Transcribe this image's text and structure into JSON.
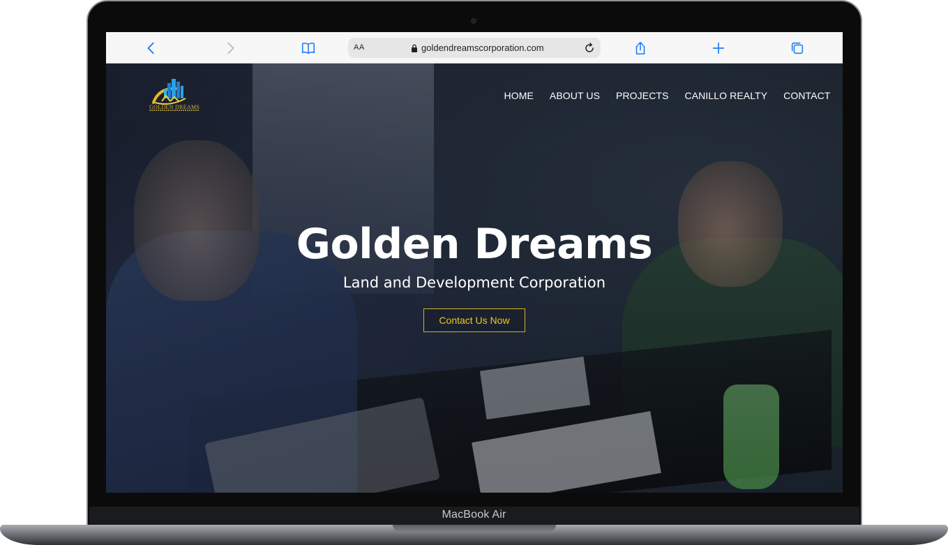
{
  "device": {
    "label": "MacBook Air"
  },
  "browser": {
    "reader_size_label": "AA",
    "url": "goldendreamscorporation.com",
    "icons": {
      "back": "chevron-left-icon",
      "forward": "chevron-right-icon",
      "bookmarks": "book-icon",
      "lock": "lock-icon",
      "reload": "reload-icon",
      "share": "share-icon",
      "new_tab": "plus-icon",
      "tabs": "tabs-icon"
    },
    "accent_color": "#1b7cf5"
  },
  "site": {
    "logo_text": "GOLDEN DREAMS",
    "nav": [
      "HOME",
      "ABOUT US",
      "PROJECTS",
      "CANILLO REALTY",
      "CONTACT"
    ],
    "hero": {
      "title": "Golden Dreams",
      "subtitle": "Land and Development Corporation",
      "cta_label": "Contact Us Now"
    },
    "colors": {
      "brand_gold": "#f0c925",
      "text": "#ffffff"
    }
  }
}
